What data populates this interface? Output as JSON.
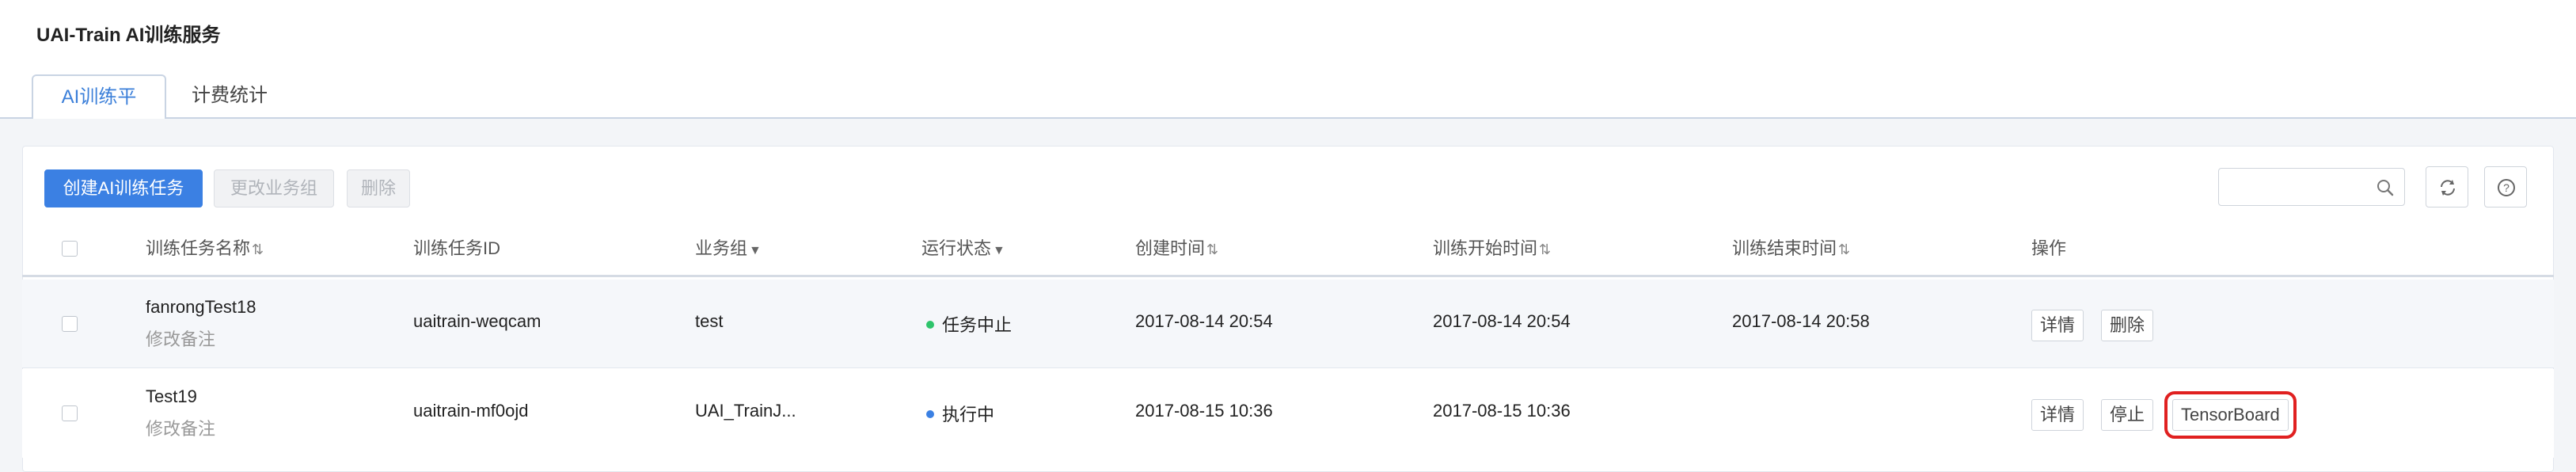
{
  "app": {
    "title": "UAI-Train AI训练服务"
  },
  "tabs": [
    {
      "label": "AI训练平台",
      "active": true
    },
    {
      "label": "计费统计",
      "active": false
    }
  ],
  "toolbar": {
    "create_label": "创建AI训练任务",
    "change_group_label": "更改业务组",
    "delete_label": "删除",
    "search_placeholder": "",
    "icons": [
      "search-icon",
      "refresh-icon",
      "help-icon"
    ]
  },
  "table": {
    "columns": [
      {
        "label": "训练任务名称",
        "sortable": true
      },
      {
        "label": "训练任务ID"
      },
      {
        "label": "业务组",
        "filter": true
      },
      {
        "label": "运行状态",
        "filter": true
      },
      {
        "label": "创建时间",
        "sortable": true
      },
      {
        "label": "训练开始时间",
        "sortable": true
      },
      {
        "label": "训练结束时间",
        "sortable": true
      },
      {
        "label": "操作"
      }
    ],
    "sort_glyph": "⇅",
    "filter_glyph": "▼",
    "rows": [
      {
        "name": "fanrongTest18",
        "note": "修改备注",
        "id": "uaitrain-weqcam",
        "group": "test",
        "status": "任务中止",
        "status_color": "#2ec46b",
        "created": "2017-08-14 20:54",
        "start": "2017-08-14 20:54",
        "end": "2017-08-14 20:58",
        "actions": [
          "详情",
          "删除"
        ]
      },
      {
        "name": "Test19",
        "note": "修改备注",
        "id": "uaitrain-mf0ojd",
        "group": "UAI_TrainJ...",
        "status": "执行中",
        "status_color": "#3b80e3",
        "created": "2017-08-15 10:36",
        "start": "2017-08-15 10:36",
        "end": "",
        "actions": [
          "详情",
          "停止",
          "TensorBoard"
        ]
      }
    ]
  },
  "colors": {
    "primary": "#3b80e3",
    "highlight": "#e02020"
  }
}
